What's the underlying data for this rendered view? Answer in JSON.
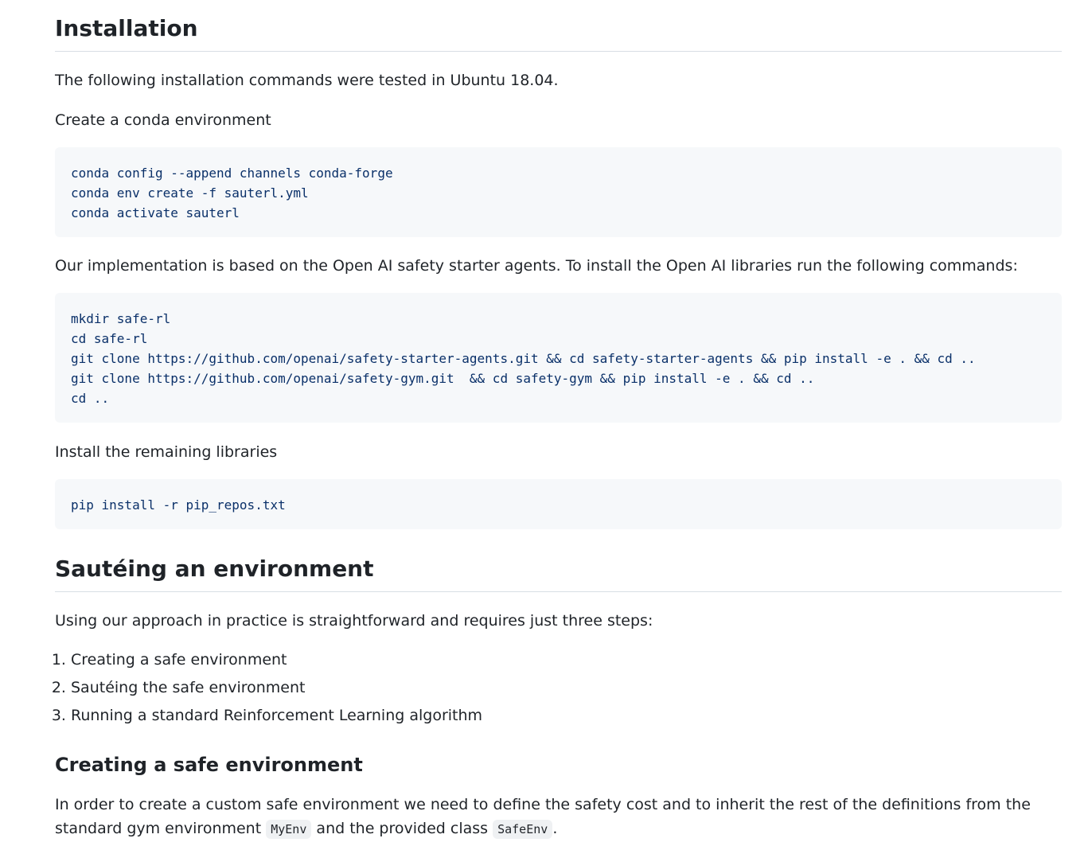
{
  "installation": {
    "heading": "Installation",
    "intro": "The following installation commands were tested in Ubuntu 18.04.",
    "conda_label": "Create a conda environment",
    "conda_code": "conda config --append channels conda-forge\nconda env create -f sauterl.yml\nconda activate sauterl",
    "openai_text": "Our implementation is based on the Open AI safety starter agents. To install the Open AI libraries run the following commands:",
    "openai_code": "mkdir safe-rl\ncd safe-rl\ngit clone https://github.com/openai/safety-starter-agents.git && cd safety-starter-agents && pip install -e . && cd ..\ngit clone https://github.com/openai/safety-gym.git  && cd safety-gym && pip install -e . && cd ..\ncd ..",
    "remaining_label": "Install the remaining libraries",
    "remaining_code": "pip install -r pip_repos.txt"
  },
  "sauteing": {
    "heading": "Sautéing an environment",
    "intro": "Using our approach in practice is straightforward and requires just three steps:",
    "steps": [
      "Creating a safe environment",
      "Sautéing the safe environment",
      "Running a standard Reinforcement Learning algorithm"
    ]
  },
  "creating": {
    "heading": "Creating a safe environment",
    "text_part1": "In order to create a custom safe environment we need to define the safety cost and to inherit the rest of the definitions from the standard gym environment",
    "code1": "MyEnv",
    "text_part2": "and the provided class",
    "code2": "SafeEnv",
    "text_part3": "."
  }
}
